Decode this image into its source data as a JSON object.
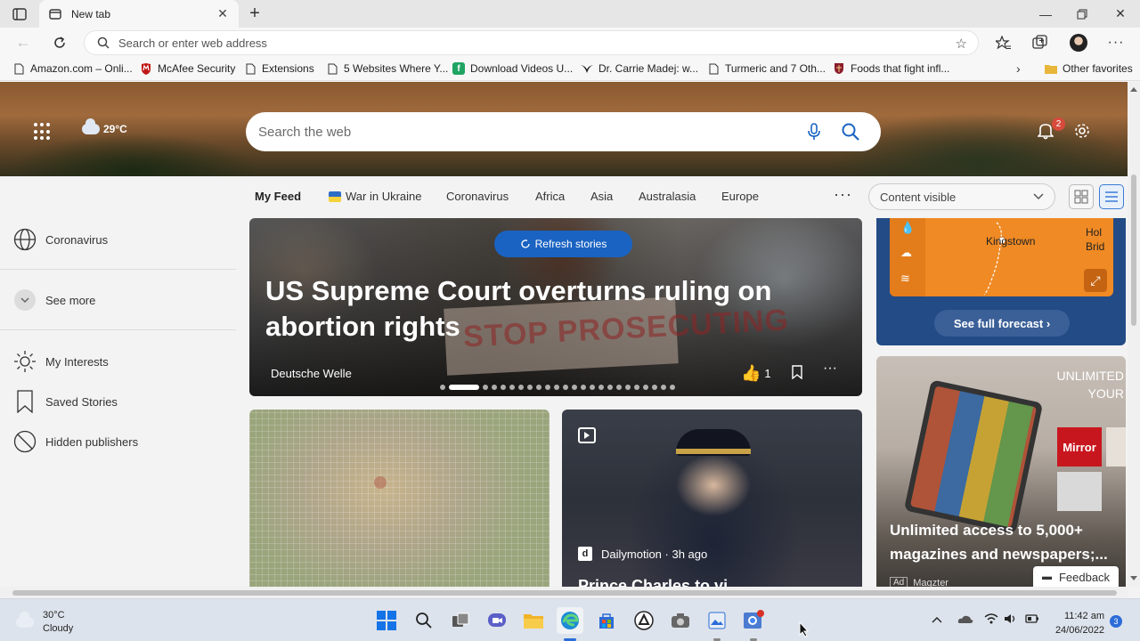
{
  "browser": {
    "tab": {
      "title": "New tab"
    },
    "address_bar": {
      "placeholder": "Search or enter web address"
    },
    "bookmarks": [
      {
        "label": "Amazon.com – Onli...",
        "icon": "page-icon"
      },
      {
        "label": "McAfee Security",
        "icon": "mcafee-shield-icon"
      },
      {
        "label": "Extensions",
        "icon": "page-icon"
      },
      {
        "label": "5 Websites Where Y...",
        "icon": "page-icon"
      },
      {
        "label": "Download Videos U...",
        "icon": "green-f-icon"
      },
      {
        "label": "Dr. Carrie Madej: w...",
        "icon": "bird-icon"
      },
      {
        "label": "Turmeric and 7 Oth...",
        "icon": "page-icon"
      },
      {
        "label": "Foods that fight infl...",
        "icon": "crest-icon"
      }
    ],
    "other_favorites": "Other favorites"
  },
  "hero": {
    "weather_temp": "29°C",
    "search_placeholder": "Search the web",
    "notification_count": "2"
  },
  "feed_nav": {
    "tabs": [
      {
        "label": "My Feed",
        "active": true
      },
      {
        "label": "War in Ukraine"
      },
      {
        "label": "Coronavirus"
      },
      {
        "label": "Africa"
      },
      {
        "label": "Asia"
      },
      {
        "label": "Australasia"
      },
      {
        "label": "Europe"
      }
    ],
    "more_label": "···",
    "content_select": "Content visible"
  },
  "sidebar": {
    "items": [
      {
        "label": "Coronavirus",
        "icon": "globe-icon"
      },
      {
        "label": "See more",
        "icon": "chevron-down-icon"
      },
      {
        "label": "My Interests",
        "icon": "sun-icon"
      },
      {
        "label": "Saved Stories",
        "icon": "bookmark-icon"
      },
      {
        "label": "Hidden publishers",
        "icon": "block-icon"
      }
    ]
  },
  "hero_card": {
    "refresh_label": "Refresh stories",
    "sign_text": "STOP PROSECUTING",
    "headline": "US Supreme Court overturns ruling on abortion rights",
    "source": "Deutsche Welle",
    "likes": "1",
    "carousel_total": 24,
    "carousel_active": 2
  },
  "weather_card": {
    "city": "Kingstown",
    "city_partial": "Hol Brid",
    "forecast_button": "See full forecast ›"
  },
  "cards": {
    "video_card": {
      "source": "Dailymotion · 3h ago",
      "source_logo": "d",
      "title_partial": "Prince Charles to vi..."
    }
  },
  "ad_card": {
    "top_text": "UNLIMITED YOUR",
    "mirror_label": "Mirror",
    "headline": "Unlimited access to 5,000+ magazines and newspapers;...",
    "ad_tag": "Ad",
    "advertiser": "Magzter"
  },
  "feedback_label": "Feedback",
  "taskbar": {
    "weather_temp": "30°C",
    "weather_desc": "Cloudy",
    "time": "11:42 am",
    "date": "24/06/2022",
    "notification_count": "3"
  },
  "colors": {
    "accent": "#1a63c2",
    "weather_card_bg": "#234b86",
    "weather_map": "#f08a24",
    "badge_red": "#d74a3c"
  }
}
